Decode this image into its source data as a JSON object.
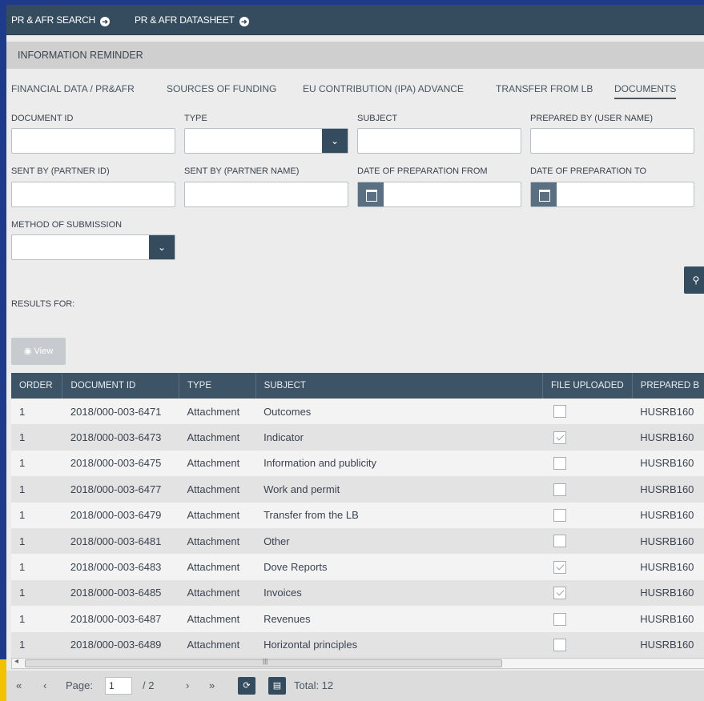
{
  "nav": {
    "link1": "PR & AFR SEARCH",
    "link2": "PR & AFR DATASHEET"
  },
  "reminder": "INFORMATION REMINDER",
  "tabs": [
    {
      "label": "FINANCIAL DATA / PR&AFR"
    },
    {
      "label": "SOURCES OF FUNDING"
    },
    {
      "label": "EU CONTRIBUTION (IPA) ADVANCE"
    },
    {
      "label": "TRANSFER FROM LB"
    },
    {
      "label": "DOCUMENTS"
    }
  ],
  "filters": {
    "document_id": "DOCUMENT ID",
    "type": "TYPE",
    "subject": "SUBJECT",
    "prepared_by": "PREPARED BY (USER NAME)",
    "sent_by_id": "SENT BY (PARTNER ID)",
    "sent_by_name": "SENT BY (PARTNER NAME)",
    "date_from": "DATE OF PREPARATION FROM",
    "date_to": "DATE OF PREPARATION TO",
    "method": "METHOD OF SUBMISSION"
  },
  "results_label": "RESULTS FOR:",
  "view_button": "View",
  "table": {
    "columns": [
      "ORDER",
      "DOCUMENT ID",
      "TYPE",
      "SUBJECT",
      "FILE UPLOADED",
      "PREPARED B"
    ],
    "rows": [
      {
        "order": "1",
        "doc_id": "2018/000-003-6471",
        "type": "Attachment",
        "subject": "Outcomes",
        "file_uploaded": false,
        "prepared_by": "HUSRB160"
      },
      {
        "order": "1",
        "doc_id": "2018/000-003-6473",
        "type": "Attachment",
        "subject": "Indicator",
        "file_uploaded": true,
        "prepared_by": "HUSRB160"
      },
      {
        "order": "1",
        "doc_id": "2018/000-003-6475",
        "type": "Attachment",
        "subject": "Information and publicity",
        "file_uploaded": false,
        "prepared_by": "HUSRB160"
      },
      {
        "order": "1",
        "doc_id": "2018/000-003-6477",
        "type": "Attachment",
        "subject": "Work and permit",
        "file_uploaded": false,
        "prepared_by": "HUSRB160"
      },
      {
        "order": "1",
        "doc_id": "2018/000-003-6479",
        "type": "Attachment",
        "subject": "Transfer from the LB",
        "file_uploaded": false,
        "prepared_by": "HUSRB160"
      },
      {
        "order": "1",
        "doc_id": "2018/000-003-6481",
        "type": "Attachment",
        "subject": "Other",
        "file_uploaded": false,
        "prepared_by": "HUSRB160"
      },
      {
        "order": "1",
        "doc_id": "2018/000-003-6483",
        "type": "Attachment",
        "subject": "Dove Reports",
        "file_uploaded": true,
        "prepared_by": "HUSRB160"
      },
      {
        "order": "1",
        "doc_id": "2018/000-003-6485",
        "type": "Attachment",
        "subject": "Invoices",
        "file_uploaded": true,
        "prepared_by": "HUSRB160"
      },
      {
        "order": "1",
        "doc_id": "2018/000-003-6487",
        "type": "Attachment",
        "subject": "Revenues",
        "file_uploaded": false,
        "prepared_by": "HUSRB160"
      },
      {
        "order": "1",
        "doc_id": "2018/000-003-6489",
        "type": "Attachment",
        "subject": "Horizontal principles",
        "file_uploaded": false,
        "prepared_by": "HUSRB160"
      }
    ]
  },
  "pager": {
    "first": "«",
    "prev": "‹",
    "page_label": "Page:",
    "page_value": "1",
    "of_pages": "/ 2",
    "next": "›",
    "last": "»",
    "total": "Total: 12"
  },
  "colors": {
    "header": "#354b5e",
    "accent_border": "#1e3a8a"
  }
}
